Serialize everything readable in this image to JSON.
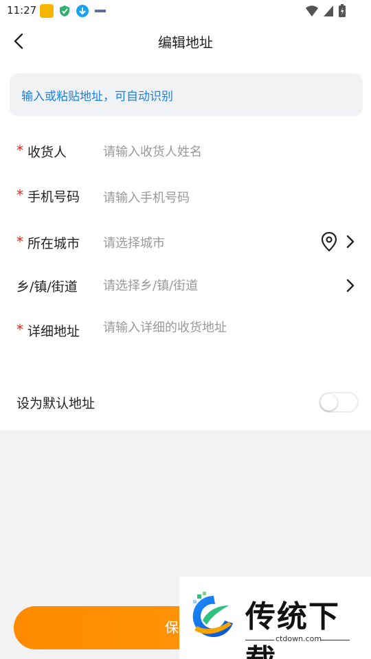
{
  "status_bar": {
    "time": "11:27",
    "app_icons": [
      "app-badge-icon",
      "shield-leaf-icon",
      "download-icon",
      "small-app-icon"
    ],
    "right_icons": [
      "wifi-icon",
      "signal-icon",
      "battery-icon"
    ]
  },
  "header": {
    "title": "编辑地址",
    "back_icon": "chevron-left-icon"
  },
  "paste_box": {
    "text": "输入或粘贴地址，可自动识别"
  },
  "form": {
    "fields": [
      {
        "label": "收货人",
        "required": true,
        "placeholder": "请输入收货人姓名"
      },
      {
        "label": "手机号码",
        "required": true,
        "placeholder": "请输入手机号码"
      },
      {
        "label": "所在城市",
        "required": true,
        "placeholder": "请选择城市",
        "icons": [
          "location-pin-icon",
          "chevron-right-icon"
        ]
      },
      {
        "label": "乡/镇/街道",
        "required": false,
        "placeholder": "请选择乡/镇/街道",
        "icons": [
          "chevron-right-icon"
        ]
      },
      {
        "label": "详细地址",
        "required": true,
        "placeholder": "请输入详细的收货地址"
      }
    ],
    "required_mark": "*"
  },
  "default_address": {
    "label": "设为默认地址",
    "enabled": false
  },
  "save_button": {
    "label": "保存收"
  },
  "watermark": {
    "brand": "传统下载",
    "domain": "ctdown.com"
  },
  "colors": {
    "accent_orange": "#ff8a00",
    "link_blue": "#1e7fe0",
    "required_red": "#e2231a"
  }
}
